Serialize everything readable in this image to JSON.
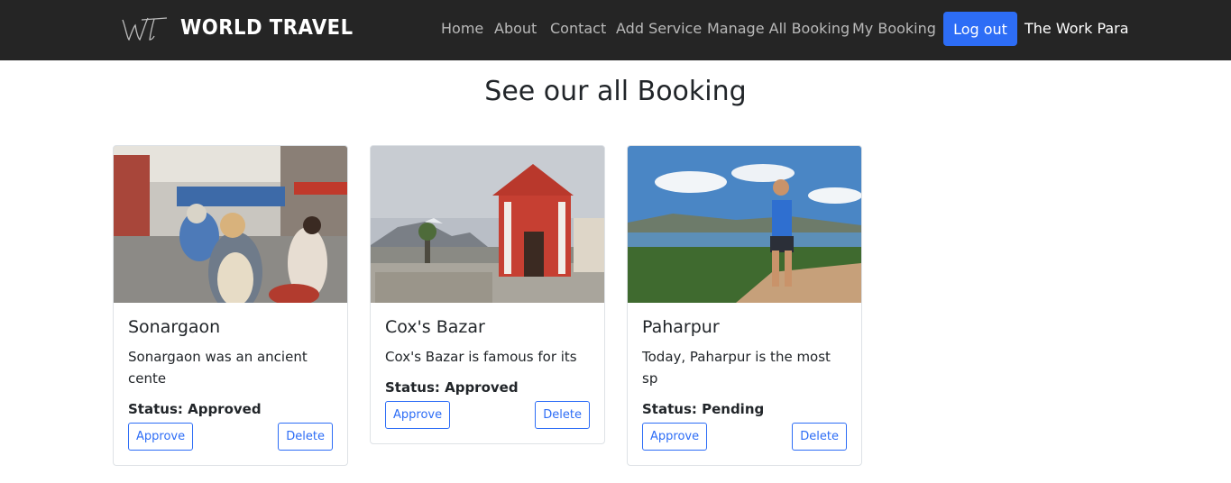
{
  "navbar": {
    "brand": "WORLD TRAVEL",
    "logo_icon": "wt-script-logo",
    "links": [
      "Home",
      "About",
      "Contact",
      "Add Service",
      "Manage All Booking",
      "My Booking"
    ],
    "logout_label": "Log out",
    "user_name": "The Work Para"
  },
  "page": {
    "title": "See our all Booking"
  },
  "bookings": [
    {
      "title": "Sonargaon",
      "description": "Sonargaon was an ancient cente",
      "status": "Status: Approved",
      "approve_label": "Approve",
      "delete_label": "Delete"
    },
    {
      "title": "Cox's Bazar",
      "description": "Cox's Bazar is famous for its",
      "status": "Status: Approved",
      "approve_label": "Approve",
      "delete_label": "Delete"
    },
    {
      "title": "Paharpur",
      "description": "Today, Paharpur is the most sp",
      "status": "Status: Pending",
      "approve_label": "Approve",
      "delete_label": "Delete"
    }
  ],
  "colors": {
    "navbar_bg": "#252525",
    "primary": "#2d6df6",
    "nav_link": "#b9b9b9"
  }
}
